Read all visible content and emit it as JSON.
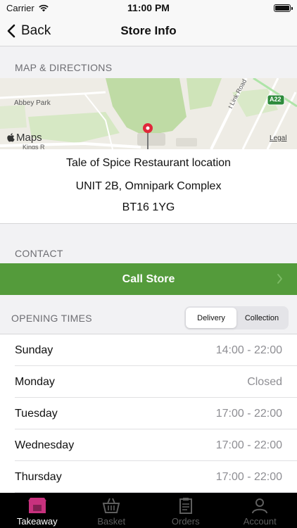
{
  "status_bar": {
    "carrier": "Carrier",
    "time": "11:00 PM"
  },
  "nav": {
    "back_label": "Back",
    "title": "Store Info"
  },
  "sections": {
    "map": "MAP & DIRECTIONS",
    "contact": "CONTACT",
    "opening": "OPENING TIMES"
  },
  "map": {
    "labels": {
      "abbey_park": "Abbey Park",
      "kings": "Kings R",
      "road": "Link Road",
      "road_prefix": "t",
      "a22": "A22",
      "legal": "Legal",
      "maps": "Maps"
    }
  },
  "store": {
    "name_line": "Tale of Spice Restaurant  location",
    "address": "UNIT 2B, Omnipark Complex",
    "postcode": "BT16 1YG"
  },
  "contact": {
    "call_label": "Call Store"
  },
  "segment": {
    "options": [
      "Delivery",
      "Collection"
    ],
    "selected": "Delivery"
  },
  "hours": [
    {
      "day": "Sunday",
      "time": "14:00 - 22:00"
    },
    {
      "day": "Monday",
      "time": "Closed"
    },
    {
      "day": "Tuesday",
      "time": "17:00 - 22:00"
    },
    {
      "day": "Wednesday",
      "time": "17:00 - 22:00"
    },
    {
      "day": "Thursday",
      "time": "17:00 - 22:00"
    }
  ],
  "tabs": [
    {
      "label": "Takeaway",
      "icon": "takeaway-icon",
      "active": true
    },
    {
      "label": "Basket",
      "icon": "basket-icon",
      "active": false
    },
    {
      "label": "Orders",
      "icon": "orders-icon",
      "active": false
    },
    {
      "label": "Account",
      "icon": "account-icon",
      "active": false
    }
  ],
  "colors": {
    "accent": "#c8317e",
    "call_green": "#549b3b",
    "tab_inactive": "#5e5e5e",
    "pin_red": "#e0283a"
  }
}
